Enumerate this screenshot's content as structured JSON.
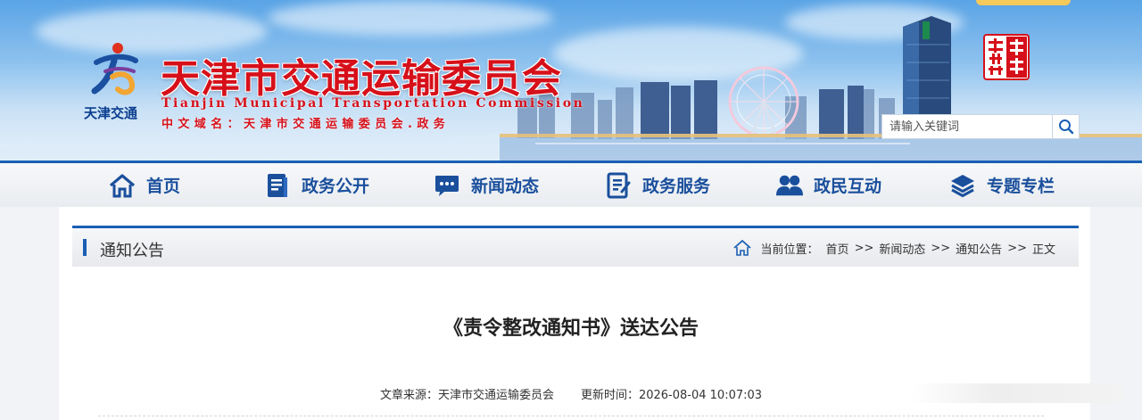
{
  "header": {
    "logo_caption": "天津交通",
    "site_title": "天津市交通运输委员会",
    "site_title_en": "Tianjin Municipal Transportation Commission",
    "domain_line": "中文域名：天津市交通运输委员会.政务",
    "seal_icon": "tianjin-zhengwu-seal-icon",
    "search": {
      "placeholder": "请输入关键词",
      "value": "",
      "icon": "search-icon"
    }
  },
  "nav": {
    "items": [
      {
        "label": "首页",
        "icon": "home-icon"
      },
      {
        "label": "政务公开",
        "icon": "document-icon"
      },
      {
        "label": "新闻动态",
        "icon": "chat-icon"
      },
      {
        "label": "政务服务",
        "icon": "service-list-icon"
      },
      {
        "label": "政民互动",
        "icon": "people-icon"
      },
      {
        "label": "专题专栏",
        "icon": "layers-icon"
      }
    ]
  },
  "section": {
    "title": "通知公告",
    "breadcrumb_label": "当前位置：",
    "breadcrumb": [
      "首页",
      "新闻动态",
      "通知公告",
      "正文"
    ],
    "separator": ">>"
  },
  "article": {
    "title": "《责令整改通知书》送达公告",
    "source_label": "文章来源：天津市交通运输委员会",
    "updated_label": "更新时间：2026-08-04 10:07:03"
  },
  "colors": {
    "brand_blue": "#1a5fb4",
    "title_red": "#d6101a",
    "nav_text": "#1a4f9c"
  }
}
